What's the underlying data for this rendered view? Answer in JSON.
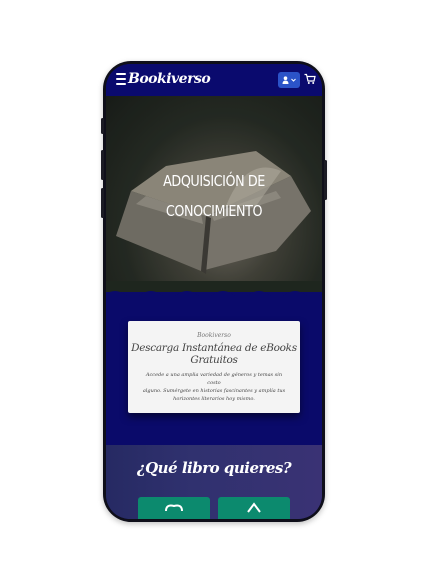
{
  "header": {
    "logo": "Bookiverso",
    "menu_icon": "hamburger-icon",
    "user_icon": "user-icon",
    "cart_icon": "cart-icon"
  },
  "hero": {
    "title_line1": "ADQUISICIÓN DE",
    "title_line2": "CONOCIMIENTO"
  },
  "card": {
    "brand": "Bookiverso",
    "title": "Descarga Instantánea de eBooks Gratuitos",
    "description_line1": "Accede a una amplia variedad de géneros y temas sin costo",
    "description_line2": "alguno. Sumérgete en historias fascinantes y amplía tus",
    "description_line3": "horizontes literarios hoy mismo."
  },
  "section": {
    "title": "¿Qué libro quieres?"
  },
  "colors": {
    "navy": "#0a0a6e",
    "accent_blue": "#2b53c8",
    "green": "#0c8a6e"
  }
}
